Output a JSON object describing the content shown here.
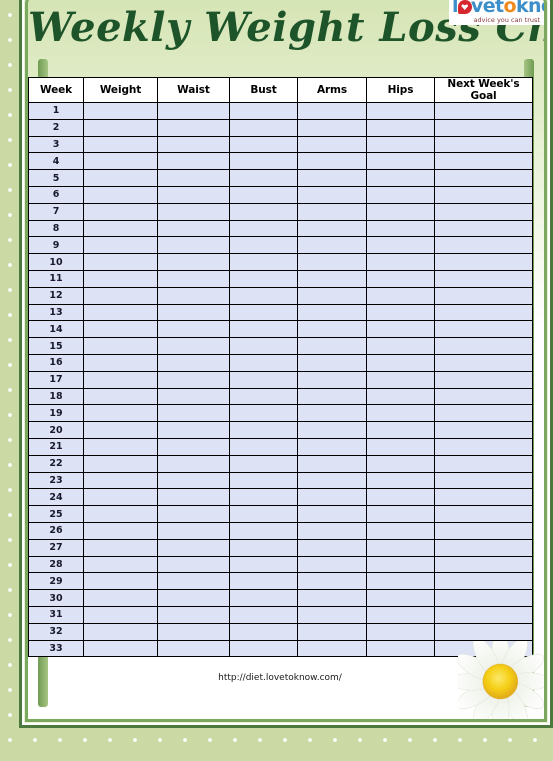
{
  "document": {
    "title": "Weekly Weight Loss Chart",
    "footer_url": "http://diet.lovetoknow.com/"
  },
  "logo": {
    "brand_part_1": "l",
    "brand_part_2": "vet",
    "brand_part_3": "o",
    "brand_part_4": "kno",
    "word_full": "lovetokno",
    "tagline": "advice you can trust",
    "heart_icon": "heart-icon",
    "colors": {
      "blue": "#3c8fc9",
      "red": "#d6272e",
      "orange": "#f08a1c",
      "tagline": "#8b3a3a"
    }
  },
  "theme": {
    "page_background": "#cbd9a5",
    "frame_outer": "#4c7a3e",
    "frame_inner": "#7aa85c",
    "title_color": "#1d5429",
    "cell_fill": "#dde2f5",
    "header_gradient_top": "#d5e4b4",
    "sheet_white": "#ffffff"
  },
  "table": {
    "columns": [
      "Week",
      "Weight",
      "Waist",
      "Bust",
      "Arms",
      "Hips",
      "Next Week's Goal"
    ],
    "week_numbers": [
      "1",
      "2",
      "3",
      "4",
      "5",
      "6",
      "7",
      "8",
      "9",
      "10",
      "11",
      "12",
      "13",
      "14",
      "15",
      "16",
      "17",
      "18",
      "19",
      "20",
      "21",
      "22",
      "23",
      "24",
      "25",
      "26",
      "27",
      "28",
      "29",
      "30",
      "31",
      "32",
      "33"
    ],
    "row_count": 33,
    "blank_cell_value": ""
  },
  "decorations": {
    "daisy": {
      "name": "daisy-flower",
      "petal_color": "#ffffff",
      "center_color": "#f5d020",
      "center_shadow": "#e0a91c"
    },
    "polka_dot_color": "#ffffff"
  }
}
